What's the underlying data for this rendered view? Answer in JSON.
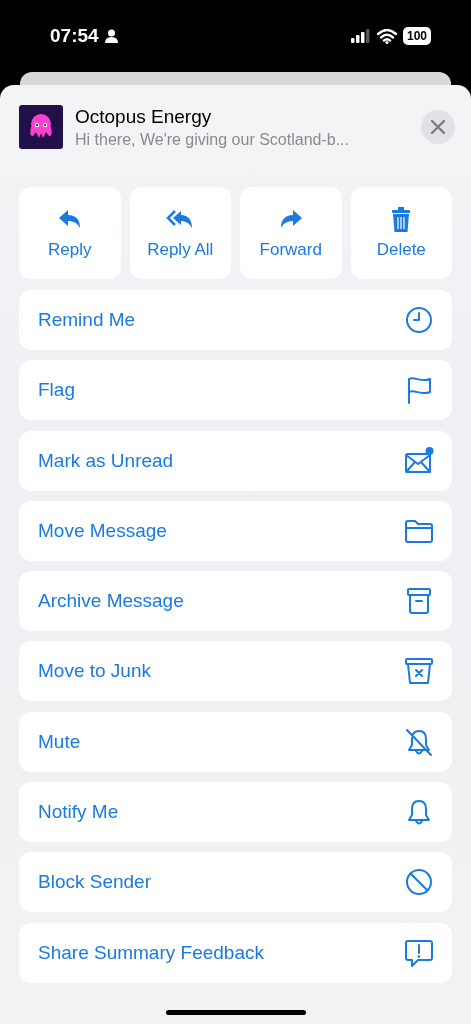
{
  "status_bar": {
    "time": "07:54",
    "battery": "100"
  },
  "message": {
    "sender": "Octopus Energy",
    "preview": "Hi there, We're giving our Scotland-b..."
  },
  "actions": [
    {
      "label": "Reply"
    },
    {
      "label": "Reply All"
    },
    {
      "label": "Forward"
    },
    {
      "label": "Delete"
    }
  ],
  "menu": [
    {
      "label": "Remind Me"
    },
    {
      "label": "Flag"
    },
    {
      "label": "Mark as Unread"
    },
    {
      "label": "Move Message"
    },
    {
      "label": "Archive Message"
    },
    {
      "label": "Move to Junk"
    },
    {
      "label": "Mute"
    },
    {
      "label": "Notify Me"
    },
    {
      "label": "Block Sender"
    },
    {
      "label": "Share Summary Feedback"
    }
  ]
}
